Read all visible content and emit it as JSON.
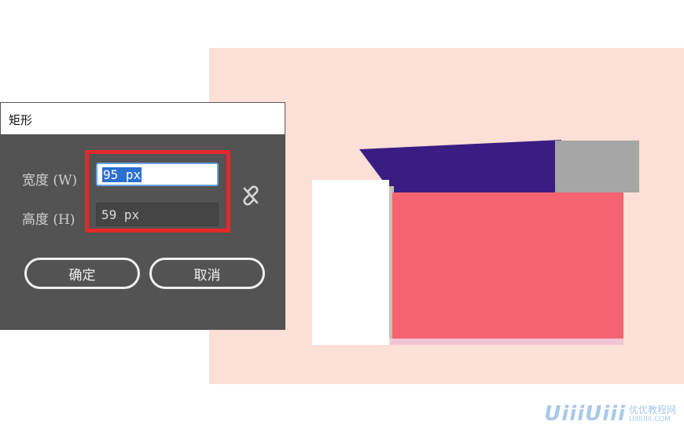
{
  "dialog": {
    "title": "矩形",
    "width_label": "宽度 (W)",
    "width_value": "95 px",
    "height_label": "高度 (H)",
    "height_value": "59 px",
    "link_icon": "unlink-icon",
    "ok_label": "确定",
    "cancel_label": "取消"
  },
  "colors": {
    "dialog_bg": "#535353",
    "highlight": "#e22a2c",
    "artboard": "#fcdfd6",
    "coral": "#f4636f",
    "purple": "#3a1d83",
    "gray": "#a6a6a6"
  },
  "watermark": {
    "logo": "UiiiUiii",
    "cn": "优优教程网",
    "url": "UIIIUIII.COM"
  }
}
